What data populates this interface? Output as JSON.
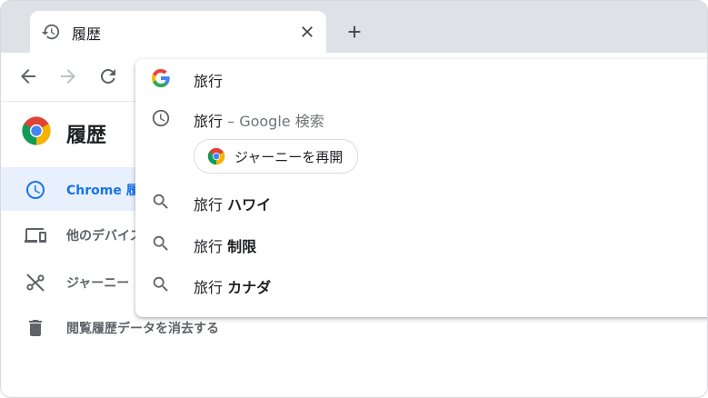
{
  "tab": {
    "title": "履歴"
  },
  "page": {
    "title": "履歴"
  },
  "sidebar": {
    "items": [
      {
        "label": "Chrome 履歴"
      },
      {
        "label": "他のデバイス"
      },
      {
        "label": "ジャーニー"
      },
      {
        "label": "閲覧履歴データを消去する"
      }
    ]
  },
  "omnibox": {
    "input_text": "旅行",
    "suggestions": [
      {
        "prefix": "旅行",
        "separator": " – ",
        "description": "Google 検索"
      },
      {
        "prefix": "旅行",
        "suffix": "ハワイ"
      },
      {
        "prefix": "旅行",
        "suffix": "制限"
      },
      {
        "prefix": "旅行",
        "suffix": "カナダ"
      }
    ],
    "journey_chip": "ジャーニーを再開"
  },
  "icons": {
    "tab": "history-icon",
    "close": "close-icon",
    "new_tab": "plus-icon",
    "back": "arrow-back-icon",
    "forward": "arrow-forward-icon",
    "reload": "reload-icon",
    "google": "google-icon",
    "search": "search-icon",
    "chrome": "chrome-logo-icon",
    "devices": "devices-icon",
    "journeys_off": "journeys-off-icon",
    "trash": "trash-icon"
  },
  "colors": {
    "accent": "#1a73e8",
    "active_bg": "#e8f0fe",
    "tabstrip_bg": "#dee1e6",
    "text_secondary": "#5f6368"
  }
}
